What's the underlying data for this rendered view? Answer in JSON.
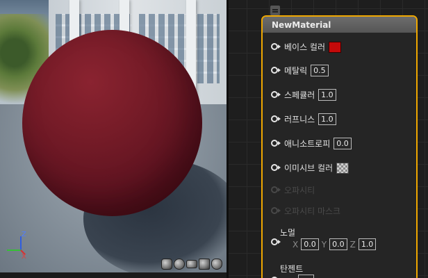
{
  "viewport": {
    "axis": {
      "z_label": "Z",
      "x_label": "X"
    },
    "preview_shapes": [
      "cylinder-icon",
      "sphere-icon",
      "plane-icon",
      "cube-icon",
      "teapot-icon"
    ],
    "sphere_color": "#6e1823"
  },
  "node": {
    "title": "NewMaterial",
    "border_color": "#f0a800",
    "pins": [
      {
        "label": "베이스 컬러",
        "kind": "color",
        "color": "#c40a0a"
      },
      {
        "label": "메탈릭",
        "kind": "value",
        "value": "0.5"
      },
      {
        "label": "스페큘러",
        "kind": "value",
        "value": "1.0"
      },
      {
        "label": "러프니스",
        "kind": "value",
        "value": "1.0"
      },
      {
        "label": "애니소트로피",
        "kind": "value",
        "value": "0.0"
      },
      {
        "label": "이미시브 컬러",
        "kind": "texture"
      },
      {
        "label": "오파시티",
        "kind": "disabled"
      },
      {
        "label": "오파시티 마스크",
        "kind": "disabled"
      },
      {
        "label": "노멀",
        "kind": "vector",
        "x_label": "X",
        "x": "0.0",
        "y_label": "Y",
        "y": "0.0",
        "z_label": "Z",
        "z": "1.0"
      },
      {
        "label": "탄젠트",
        "kind": "vector"
      }
    ]
  }
}
